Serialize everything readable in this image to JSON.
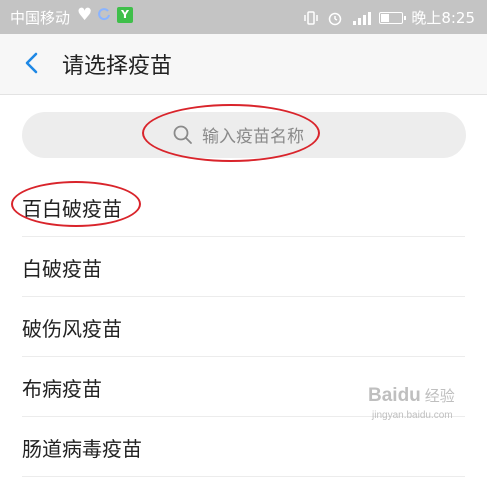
{
  "status_bar": {
    "carrier": "中国移动",
    "app_badge": "Y",
    "time": "晚上8:25",
    "battery_level": 0.4
  },
  "header": {
    "title": "请选择疫苗"
  },
  "search": {
    "placeholder": "输入疫苗名称"
  },
  "vaccine_list": [
    {
      "label": "百白破疫苗"
    },
    {
      "label": "白破疫苗"
    },
    {
      "label": "破伤风疫苗"
    },
    {
      "label": "布病疫苗"
    },
    {
      "label": "肠道病毒疫苗"
    }
  ],
  "watermark": {
    "brand": "Baidu",
    "sub": "经验",
    "url": "jingyan.baidu.com"
  },
  "colors": {
    "accent": "#1e88e5",
    "annotation": "#d9242b"
  }
}
